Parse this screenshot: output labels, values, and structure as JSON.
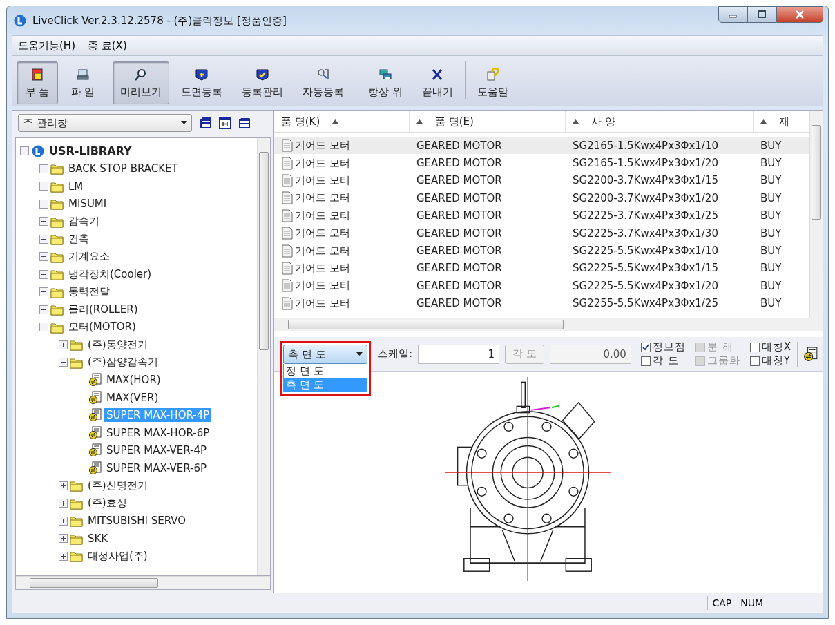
{
  "window": {
    "title": "LiveClick Ver.2.3.12.2578 - (주)클릭정보 [정품인증]"
  },
  "menu": [
    {
      "label": "도움기능(H)"
    },
    {
      "label": "종 료(X)"
    }
  ],
  "toolbar": [
    {
      "label": "부 품",
      "kind": "part",
      "selected": true,
      "separator_before": false
    },
    {
      "label": "파 일",
      "kind": "file",
      "selected": false,
      "separator_before": false
    },
    {
      "label": "미리보기",
      "kind": "preview",
      "selected": true,
      "separator_before": true
    },
    {
      "label": "도면등록",
      "kind": "register",
      "selected": false,
      "separator_before": false
    },
    {
      "label": "등록관리",
      "kind": "manage",
      "selected": false,
      "separator_before": false
    },
    {
      "label": "자동등록",
      "kind": "auto",
      "selected": false,
      "separator_before": false
    },
    {
      "label": "항상 위",
      "kind": "ontop",
      "selected": false,
      "separator_before": true
    },
    {
      "label": "끝내기",
      "kind": "exit",
      "selected": false,
      "separator_before": false
    },
    {
      "label": "도움말",
      "kind": "help",
      "selected": false,
      "separator_before": true
    }
  ],
  "left_pane": {
    "view_select": {
      "value": "주 관리창"
    },
    "tree": [
      {
        "label": "USR-LIBRARY",
        "kind": "library",
        "expanded": true,
        "selected": false,
        "children": [
          {
            "label": "BACK STOP BRACKET",
            "kind": "folder",
            "expanded": false,
            "selected": false
          },
          {
            "label": "LM",
            "kind": "folder",
            "expanded": false,
            "selected": false
          },
          {
            "label": "MISUMI",
            "kind": "folder",
            "expanded": false,
            "selected": false
          },
          {
            "label": "감속기",
            "kind": "folder",
            "expanded": false,
            "selected": false
          },
          {
            "label": "건축",
            "kind": "folder",
            "expanded": false,
            "selected": false
          },
          {
            "label": "기계요소",
            "kind": "folder",
            "expanded": false,
            "selected": false
          },
          {
            "label": "냉각장치(Cooler)",
            "kind": "folder",
            "expanded": false,
            "selected": false
          },
          {
            "label": "동력전달",
            "kind": "folder",
            "expanded": false,
            "selected": false
          },
          {
            "label": "롤러(ROLLER)",
            "kind": "folder",
            "expanded": false,
            "selected": false
          },
          {
            "label": "모터(MOTOR)",
            "kind": "folder",
            "expanded": true,
            "selected": false,
            "children": [
              {
                "label": "(주)동양전기",
                "kind": "folder",
                "expanded": false,
                "selected": false
              },
              {
                "label": "(주)삼양감속기",
                "kind": "folder",
                "expanded": true,
                "selected": false,
                "children": [
                  {
                    "label": "MAX(HOR)",
                    "kind": "part",
                    "selected": false
                  },
                  {
                    "label": "MAX(VER)",
                    "kind": "part",
                    "selected": false
                  },
                  {
                    "label": "SUPER MAX-HOR-4P",
                    "kind": "part",
                    "selected": true
                  },
                  {
                    "label": "SUPER MAX-HOR-6P",
                    "kind": "part",
                    "selected": false
                  },
                  {
                    "label": "SUPER MAX-VER-4P",
                    "kind": "part",
                    "selected": false
                  },
                  {
                    "label": "SUPER MAX-VER-6P",
                    "kind": "part",
                    "selected": false
                  }
                ]
              },
              {
                "label": "(주)신명전기",
                "kind": "folder",
                "expanded": false,
                "selected": false
              },
              {
                "label": "(주)효성",
                "kind": "folder",
                "expanded": false,
                "selected": false
              },
              {
                "label": "MITSUBISHI SERVO",
                "kind": "folder",
                "expanded": false,
                "selected": false
              },
              {
                "label": "SKK",
                "kind": "folder",
                "expanded": false,
                "selected": false
              },
              {
                "label": "대성사업(주)",
                "kind": "folder",
                "expanded": false,
                "selected": false
              }
            ]
          }
        ]
      }
    ]
  },
  "table": {
    "columns": [
      {
        "label": "품 명(K)"
      },
      {
        "label": "품 명(E)"
      },
      {
        "label": "사 양"
      },
      {
        "label": "재"
      }
    ],
    "rows": [
      {
        "selected": true,
        "cells": [
          "기어드 모터",
          "GEARED MOTOR",
          "SG2165-1.5Kwx4Px3Φx1/10",
          "BUY"
        ]
      },
      {
        "selected": false,
        "cells": [
          "기어드 모터",
          "GEARED MOTOR",
          "SG2165-1.5Kwx4Px3Φx1/20",
          "BUY"
        ]
      },
      {
        "selected": false,
        "cells": [
          "기어드 모터",
          "GEARED MOTOR",
          "SG2200-3.7Kwx4Px3Φx1/15",
          "BUY"
        ]
      },
      {
        "selected": false,
        "cells": [
          "기어드 모터",
          "GEARED MOTOR",
          "SG2200-3.7Kwx4Px3Φx1/20",
          "BUY"
        ]
      },
      {
        "selected": false,
        "cells": [
          "기어드 모터",
          "GEARED MOTOR",
          "SG2225-3.7Kwx4Px3Φx1/25",
          "BUY"
        ]
      },
      {
        "selected": false,
        "cells": [
          "기어드 모터",
          "GEARED MOTOR",
          "SG2225-3.7Kwx4Px3Φx1/30",
          "BUY"
        ]
      },
      {
        "selected": false,
        "cells": [
          "기어드 모터",
          "GEARED MOTOR",
          "SG2225-5.5Kwx4Px3Φx1/10",
          "BUY"
        ]
      },
      {
        "selected": false,
        "cells": [
          "기어드 모터",
          "GEARED MOTOR",
          "SG2225-5.5Kwx4Px3Φx1/15",
          "BUY"
        ]
      },
      {
        "selected": false,
        "cells": [
          "기어드 모터",
          "GEARED MOTOR",
          "SG2225-5.5Kwx4Px3Φx1/20",
          "BUY"
        ]
      },
      {
        "selected": false,
        "cells": [
          "기어드 모터",
          "GEARED MOTOR",
          "SG2255-5.5Kwx4Px3Φx1/25",
          "BUY"
        ]
      }
    ]
  },
  "preview": {
    "view_dropdown": {
      "value": "측 면 도",
      "expanded": true,
      "options": [
        {
          "label": "정 면 도",
          "selected": false
        },
        {
          "label": "측 면 도",
          "selected": true
        }
      ]
    },
    "scale": {
      "label": "스케일:",
      "value": "1"
    },
    "angle_button": {
      "label": "각 도",
      "disabled": true
    },
    "angle_field": {
      "value": "0.00",
      "disabled": true
    },
    "checkboxes": [
      {
        "label": "정보점",
        "checked": true,
        "disabled": false
      },
      {
        "label": "각 도",
        "checked": false,
        "disabled": false
      },
      {
        "label": "분 해",
        "checked": false,
        "disabled": true
      },
      {
        "label": "그룹화",
        "checked": false,
        "disabled": true
      },
      {
        "label": "대칭X",
        "checked": false,
        "disabled": false
      },
      {
        "label": "대칭Y",
        "checked": false,
        "disabled": false
      }
    ]
  },
  "status_bar": [
    {
      "label": "CAP"
    },
    {
      "label": "NUM"
    }
  ]
}
